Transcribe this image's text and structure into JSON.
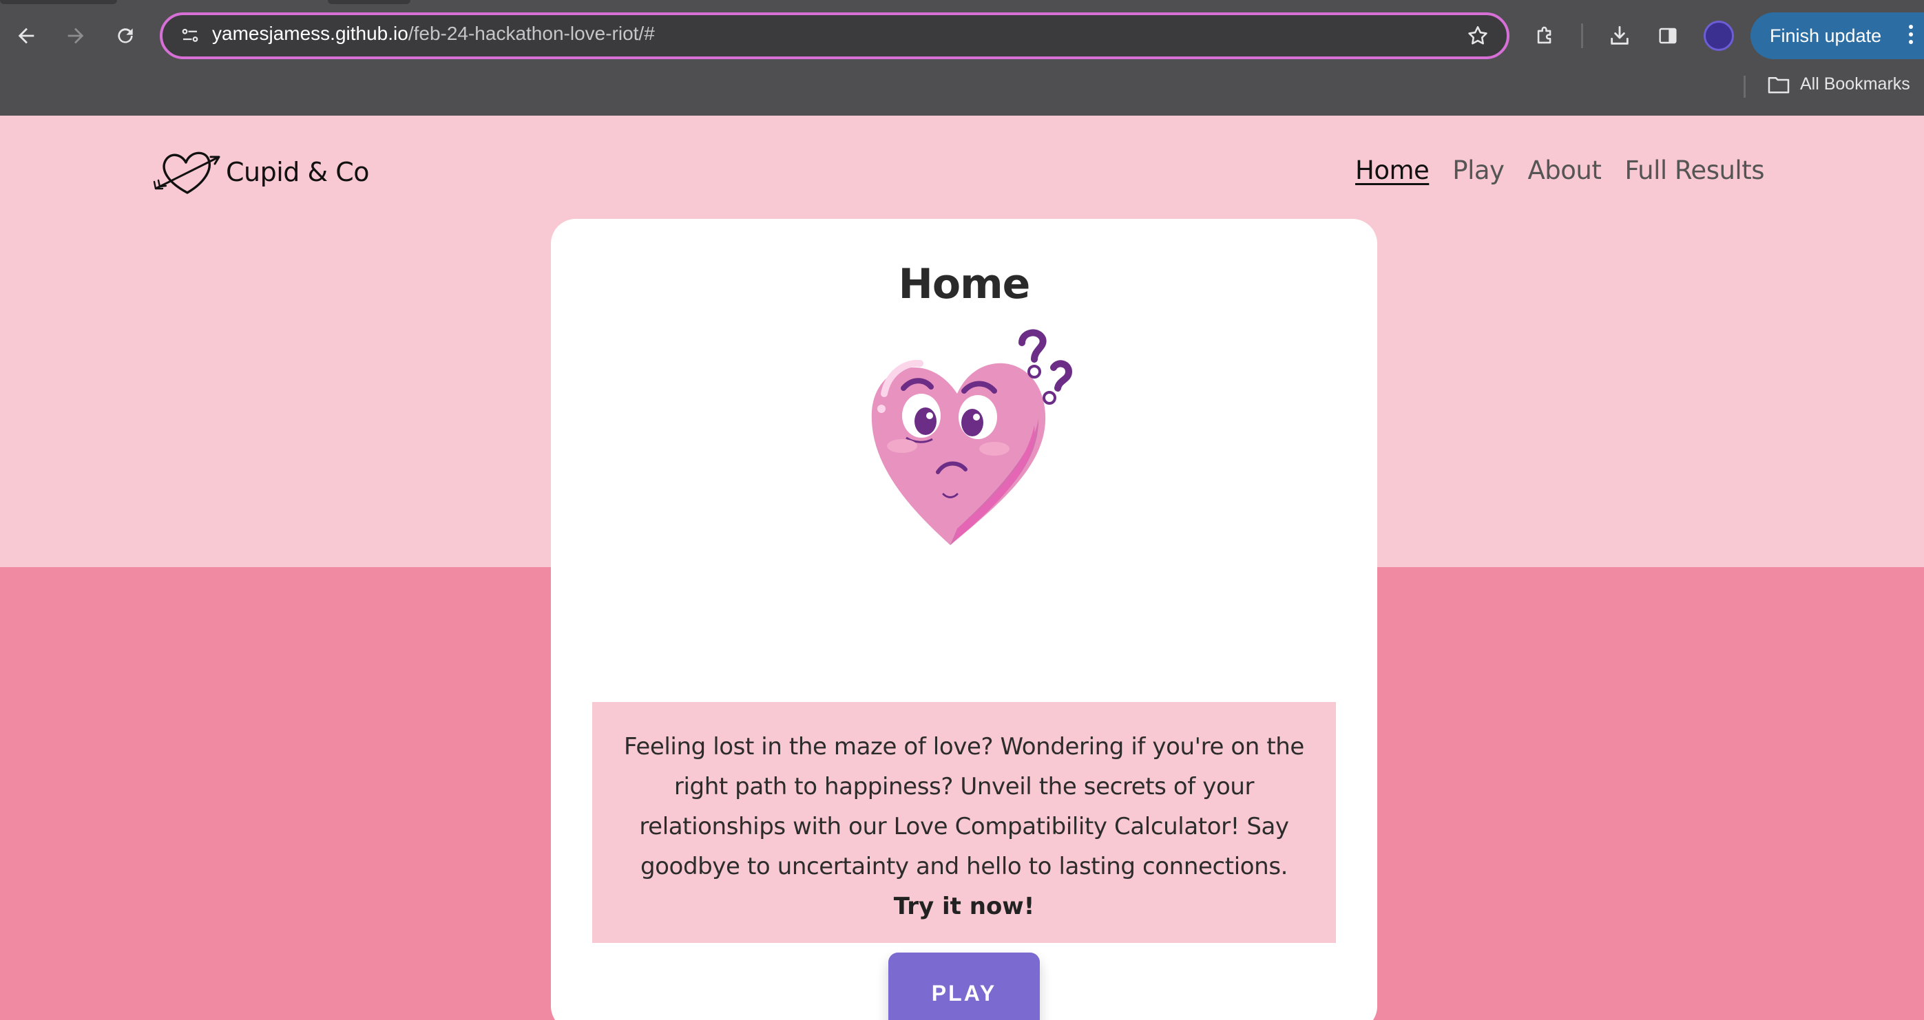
{
  "browser": {
    "url_host": "yamesjamess.github.io",
    "url_path": "/feb-24-hackathon-love-riot/#",
    "update_label": "Finish update",
    "bookmarks_label": "All Bookmarks",
    "accent_color": "#d770d6",
    "update_color": "#2c6ea3"
  },
  "site": {
    "brand": "Cupid & Co",
    "nav": [
      {
        "label": "Home",
        "active": true
      },
      {
        "label": "Play",
        "active": false
      },
      {
        "label": "About",
        "active": false
      },
      {
        "label": "Full Results",
        "active": false
      }
    ],
    "colors": {
      "top_band": "#f8c9d3",
      "bottom_band": "#f08aa2",
      "button": "#7b6ad0",
      "heart": "#e892bf"
    }
  },
  "card": {
    "title": "Home",
    "image": "confused-heart-illustration",
    "intro": "Feeling lost in the maze of love? Wondering if you're on the right path to happiness? Unveil the secrets of your relationships with our Love Compatibility Calculator! Say goodbye to uncertainty and hello to lasting connections.",
    "cta": "Try it now!",
    "play_label": "PLAY"
  }
}
